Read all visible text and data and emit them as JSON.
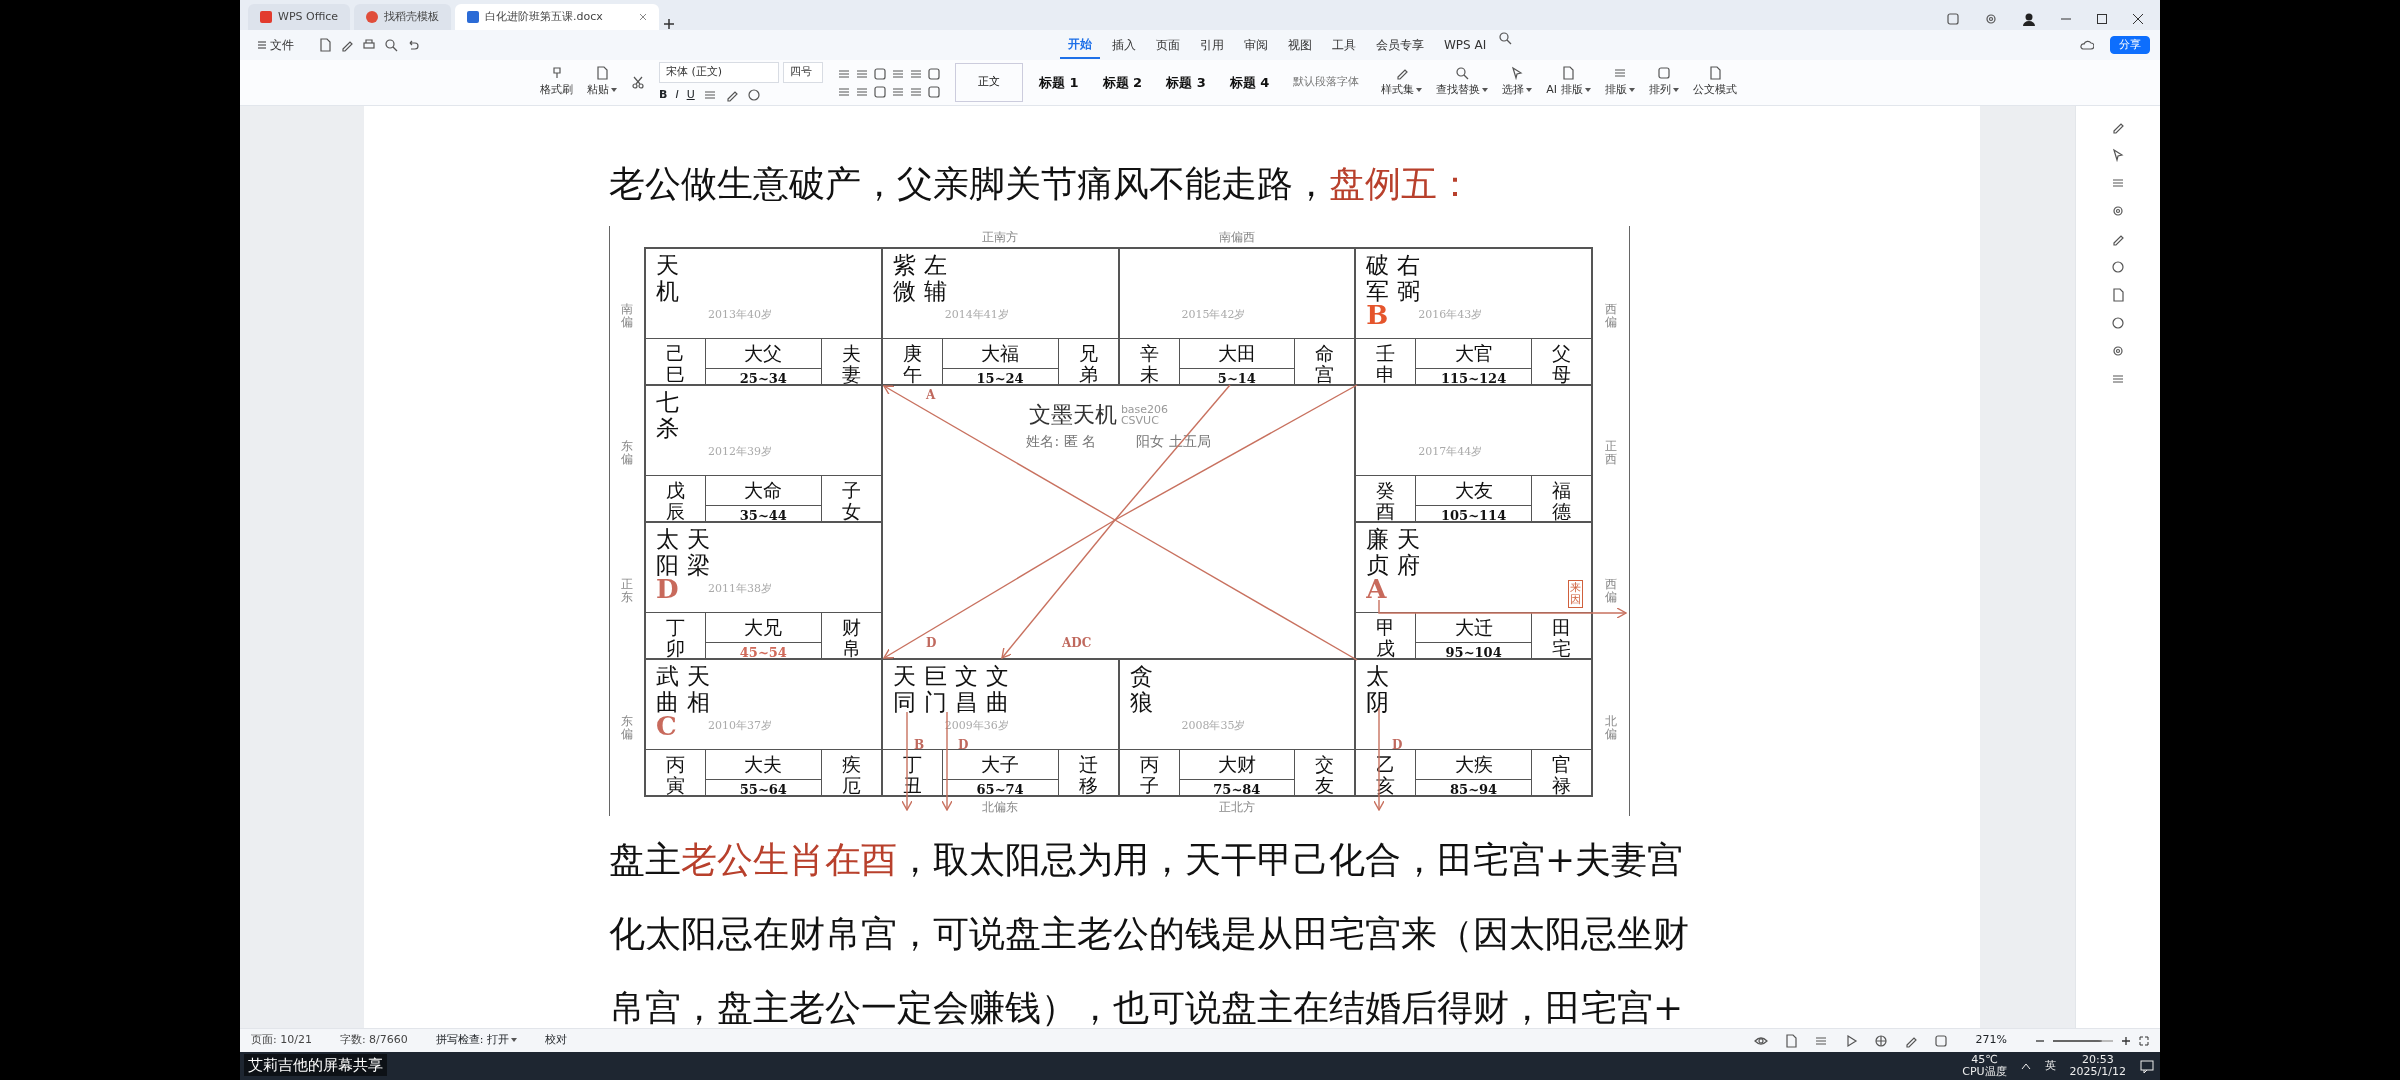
{
  "tabs": [
    {
      "label": "WPS Office",
      "selected": false,
      "kind": "home"
    },
    {
      "label": "找稻壳模板",
      "selected": false,
      "kind": "template"
    },
    {
      "label": "白化进阶班第五课.docx",
      "selected": true,
      "kind": "doc"
    }
  ],
  "menu": {
    "file": "文件",
    "tabs": [
      {
        "label": "开始",
        "selected": true
      },
      {
        "label": "插入",
        "selected": false
      },
      {
        "label": "页面",
        "selected": false
      },
      {
        "label": "引用",
        "selected": false
      },
      {
        "label": "审阅",
        "selected": false
      },
      {
        "label": "视图",
        "selected": false
      },
      {
        "label": "工具",
        "selected": false
      },
      {
        "label": "会员专享",
        "selected": false
      },
      {
        "label": "WPS AI",
        "selected": false
      }
    ],
    "share": "分享"
  },
  "ribbon": {
    "format_painter": "格式刷",
    "paste": "粘贴",
    "font": "宋体 (正文)",
    "size": "四号",
    "format_buttons": [
      "B",
      "I",
      "U"
    ],
    "styles": [
      {
        "label": "正文",
        "selected": true
      },
      {
        "label": "标题 1",
        "selected": false
      },
      {
        "label": "标题 2",
        "selected": false
      },
      {
        "label": "标题 3",
        "selected": false
      },
      {
        "label": "标题 4",
        "selected": false
      },
      {
        "label": "默认段落字体",
        "selected": false
      }
    ],
    "tools": [
      {
        "label": "样式集",
        "dropdown": true
      },
      {
        "label": "查找替换",
        "dropdown": true
      },
      {
        "label": "选择",
        "dropdown": true
      },
      {
        "label": "AI 排版",
        "dropdown": true
      },
      {
        "label": "排版",
        "dropdown": true
      },
      {
        "label": "排列",
        "dropdown": true
      },
      {
        "label": "公文模式",
        "dropdown": false
      }
    ]
  },
  "document": {
    "heading": [
      {
        "text": "老公做生意破产，父亲脚关节痛风不能走路，",
        "red": false
      },
      {
        "text": "盘例五：",
        "red": true
      }
    ],
    "chart": {
      "top_labels": [
        "正南方",
        "南偏西"
      ],
      "bottom_labels": [
        "北偏东",
        "正北方"
      ],
      "left_labels": [
        "南偏",
        "东偏",
        "正东",
        "东偏"
      ],
      "right_labels": [
        "西偏",
        "正西",
        "西偏",
        "北偏"
      ],
      "palaces": [
        {
          "stars": [
            "天机"
          ],
          "year": "2013年40岁",
          "ganzhi": "己巳",
          "decade": "大父",
          "range": "25~34",
          "range_red": false,
          "palace": "夫妻"
        },
        {
          "stars": [
            "紫微",
            "左辅"
          ],
          "year": "2014年41岁",
          "ganzhi": "庚午",
          "decade": "大福",
          "range": "15~24",
          "range_red": false,
          "palace": "兄弟"
        },
        {
          "year": "2015年42岁",
          "ganzhi": "辛未",
          "decade": "大田",
          "range": "5~14",
          "range_red": false,
          "palace": "命宫"
        },
        {
          "stars": [
            "破军",
            "右弼"
          ],
          "mark": "B",
          "year": "2016年43岁",
          "ganzhi": "壬申",
          "decade": "大官",
          "range": "115~124",
          "range_red": false,
          "palace": "父母"
        },
        {
          "stars": [
            "七杀"
          ],
          "year": "2012年39岁",
          "ganzhi": "戊辰",
          "decade": "大命",
          "range": "35~44",
          "range_red": false,
          "palace": "子女"
        },
        {
          "year": "2017年44岁",
          "ganzhi": "癸酉",
          "decade": "大友",
          "range": "105~114",
          "range_red": false,
          "palace": "福德"
        },
        {
          "stars": [
            "太阳",
            "天梁"
          ],
          "mark": "D",
          "year": "2011年38岁",
          "ganzhi": "丁卯",
          "decade": "大兄",
          "range": "45~54",
          "range_red": true,
          "palace": "财帛"
        },
        {
          "stars": [
            "廉贞",
            "天府"
          ],
          "mark": "A",
          "stamp": "来因",
          "ganzhi": "甲戌",
          "decade": "大迁",
          "range": "95~104",
          "range_red": false,
          "palace": "田宅"
        },
        {
          "stars": [
            "武曲",
            "天相"
          ],
          "mark": "C",
          "year": "2010年37岁",
          "ganzhi": "丙寅",
          "decade": "大夫",
          "range": "55~64",
          "range_red": false,
          "palace": "疾厄"
        },
        {
          "stars": [
            "天同",
            "巨门",
            "文昌",
            "文曲"
          ],
          "year": "2009年36岁",
          "ganzhi": "丁丑",
          "decade": "大子",
          "range": "65~74",
          "range_red": false,
          "palace": "迁移"
        },
        {
          "stars": [
            "贪狼"
          ],
          "year": "2008年35岁",
          "ganzhi": "丙子",
          "decade": "大财",
          "range": "75~84",
          "range_red": false,
          "palace": "交友"
        },
        {
          "stars": [
            "太阴"
          ],
          "ganzhi": "乙亥",
          "decade": "大疾",
          "range": "85~94",
          "range_red": false,
          "palace": "官禄"
        }
      ],
      "center": {
        "title": "文墨天机",
        "version": "base206",
        "code": "CSVUC",
        "name": "姓名: 匿 名",
        "info": "阳女 土五局"
      },
      "arrow_labels": [
        "A",
        "D",
        "ADC",
        "B",
        "D",
        "D"
      ]
    },
    "paragraph": [
      [
        {
          "text": "盘主",
          "red": false
        },
        {
          "text": "老公生肖在酉",
          "red": true
        },
        {
          "text": "，取太阳忌为用，天干甲己化合，田宅宫+夫妻宫",
          "red": false
        }
      ],
      [
        {
          "text": "化太阳忌在财帛宫，可说盘主老公的钱是从田宅宫来（因太阳忌坐财",
          "red": false
        }
      ],
      [
        {
          "text": "帛宫，盘主老公一定会赚钱），也可说盘主在结婚后得财，田宅宫+",
          "red": false
        }
      ]
    ]
  },
  "status_bar": {
    "page": "页面: 10/21",
    "words": "字数: 8/7660",
    "spell": "拼写检查: 打开",
    "proof": "校对",
    "zoom": "271%",
    "zoom_slider": {
      "level": 0.75
    }
  },
  "screen_share": "艾莉吉他的屏幕共享",
  "taskbar": {
    "temp": "45℃",
    "temp_label": "CPU温度",
    "lang": "英",
    "time": "20:53",
    "date": "2025/1/12"
  }
}
